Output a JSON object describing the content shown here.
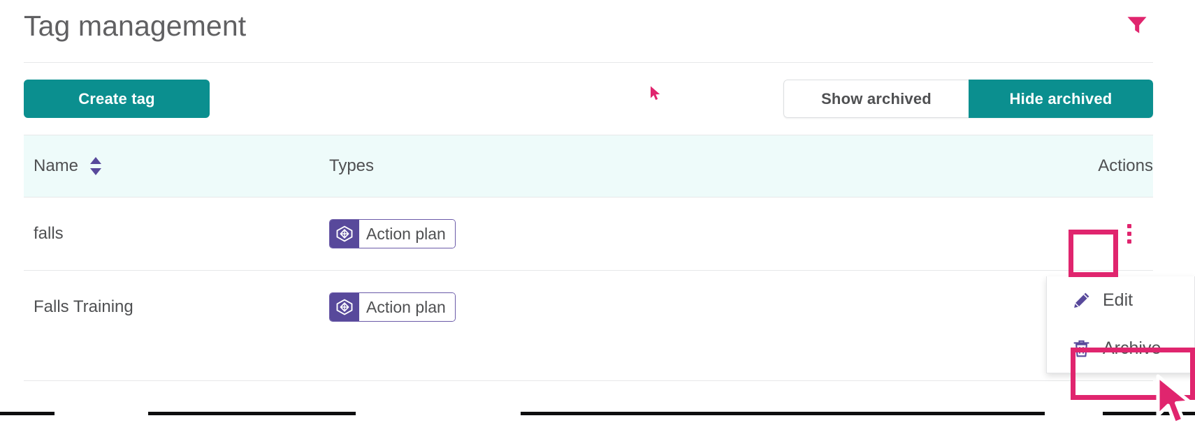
{
  "header": {
    "title": "Tag management",
    "filter_icon": "filter-funnel-icon",
    "filter_color": "#e0256e"
  },
  "toolbar": {
    "create_tag_label": "Create tag",
    "create_tag_color": "#0b8f8f",
    "segmented": {
      "show_archived_label": "Show archived",
      "hide_archived_label": "Hide archived",
      "active": "Hide archived",
      "active_color": "#0b8f8f"
    }
  },
  "table": {
    "header_background": "#eefbfa",
    "columns": [
      {
        "key": "name",
        "label": "Name",
        "sortable": true,
        "sort_icon": "sort-updown-icon"
      },
      {
        "key": "types",
        "label": "Types",
        "sortable": false
      },
      {
        "key": "actions",
        "label": "Actions",
        "sortable": false
      }
    ],
    "rows": [
      {
        "name": "falls",
        "types": [
          {
            "label": "Action plan",
            "icon": "cube-icon",
            "color": "#58499b"
          }
        ],
        "actions_icon": "kebab-menu-icon"
      },
      {
        "name": "Falls Training",
        "types": [
          {
            "label": "Action plan",
            "icon": "cube-icon",
            "color": "#58499b"
          }
        ],
        "actions_icon": "kebab-menu-icon"
      }
    ]
  },
  "dropdown": {
    "open": true,
    "items": [
      {
        "label": "Edit",
        "icon": "pencil-icon",
        "highlighted": false
      },
      {
        "label": "Archive",
        "icon": "trash-icon",
        "highlighted": true
      }
    ]
  },
  "annotations": {
    "color": "#e0256e",
    "boxes": [
      "kebab-menu-button",
      "archive-menu-item"
    ]
  },
  "cursors": [
    {
      "name": "small-pointer",
      "color": "#e0256e"
    },
    {
      "name": "main-pointer",
      "color": "#e0256e"
    }
  ]
}
